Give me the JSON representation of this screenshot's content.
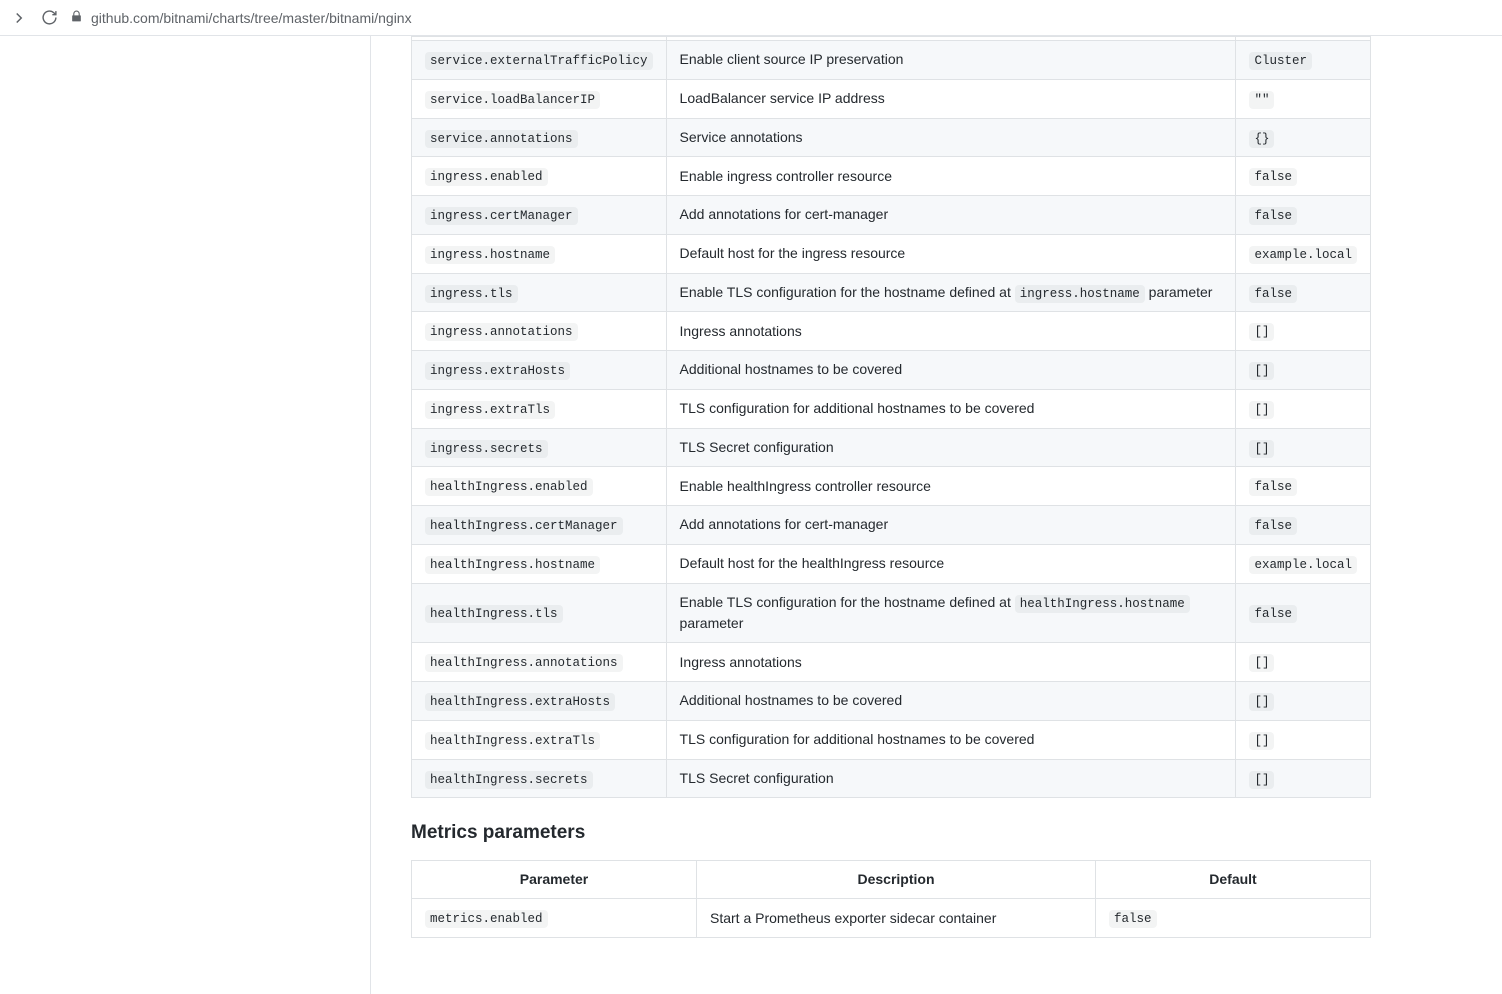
{
  "url": "github.com/bitnami/charts/tree/master/bitnami/nginx",
  "table1": {
    "rows": [
      {
        "param": "service.externalTrafficPolicy",
        "desc_parts": [
          "Enable client source IP preservation"
        ],
        "default": "Cluster"
      },
      {
        "param": "service.loadBalancerIP",
        "desc_parts": [
          "LoadBalancer service IP address"
        ],
        "default": "\"\""
      },
      {
        "param": "service.annotations",
        "desc_parts": [
          "Service annotations"
        ],
        "default": "{}"
      },
      {
        "param": "ingress.enabled",
        "desc_parts": [
          "Enable ingress controller resource"
        ],
        "default": "false"
      },
      {
        "param": "ingress.certManager",
        "desc_parts": [
          "Add annotations for cert-manager"
        ],
        "default": "false"
      },
      {
        "param": "ingress.hostname",
        "desc_parts": [
          "Default host for the ingress resource"
        ],
        "default": "example.local"
      },
      {
        "param": "ingress.tls",
        "desc_parts": [
          "Enable TLS configuration for the hostname defined at ",
          {
            "code": "ingress.hostname"
          },
          " parameter"
        ],
        "default": "false"
      },
      {
        "param": "ingress.annotations",
        "desc_parts": [
          "Ingress annotations"
        ],
        "default": "[]"
      },
      {
        "param": "ingress.extraHosts",
        "desc_parts": [
          "Additional hostnames to be covered"
        ],
        "default": "[]"
      },
      {
        "param": "ingress.extraTls",
        "desc_parts": [
          "TLS configuration for additional hostnames to be covered"
        ],
        "default": "[]"
      },
      {
        "param": "ingress.secrets",
        "desc_parts": [
          "TLS Secret configuration"
        ],
        "default": "[]"
      },
      {
        "param": "healthIngress.enabled",
        "desc_parts": [
          "Enable healthIngress controller resource"
        ],
        "default": "false"
      },
      {
        "param": "healthIngress.certManager",
        "desc_parts": [
          "Add annotations for cert-manager"
        ],
        "default": "false"
      },
      {
        "param": "healthIngress.hostname",
        "desc_parts": [
          "Default host for the healthIngress resource"
        ],
        "default": "example.local"
      },
      {
        "param": "healthIngress.tls",
        "desc_parts": [
          "Enable TLS configuration for the hostname defined at ",
          {
            "code": "healthIngress.hostname"
          },
          " parameter"
        ],
        "default": "false"
      },
      {
        "param": "healthIngress.annotations",
        "desc_parts": [
          "Ingress annotations"
        ],
        "default": "[]"
      },
      {
        "param": "healthIngress.extraHosts",
        "desc_parts": [
          "Additional hostnames to be covered"
        ],
        "default": "[]"
      },
      {
        "param": "healthIngress.extraTls",
        "desc_parts": [
          "TLS configuration for additional hostnames to be covered"
        ],
        "default": "[]"
      },
      {
        "param": "healthIngress.secrets",
        "desc_parts": [
          "TLS Secret configuration"
        ],
        "default": "[]"
      }
    ]
  },
  "section2_heading": "Metrics parameters",
  "table2": {
    "headers": {
      "param": "Parameter",
      "desc": "Description",
      "default": "Default"
    },
    "rows": [
      {
        "param": "metrics.enabled",
        "desc_parts": [
          "Start a Prometheus exporter sidecar container"
        ],
        "default": "false"
      }
    ]
  }
}
